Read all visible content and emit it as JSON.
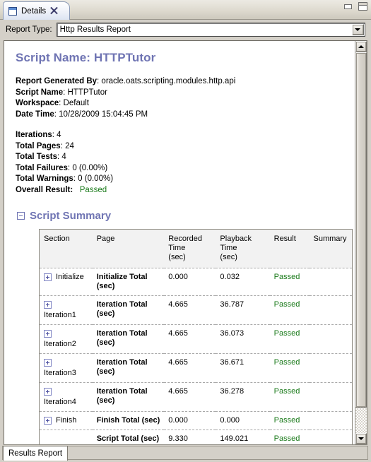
{
  "window": {
    "tab_label": "Details",
    "doc_icon": "document-icon",
    "close_icon": "close-icon",
    "minimize_icon": "minimize-icon",
    "maximize_icon": "maximize-icon"
  },
  "toolbar": {
    "report_type_label": "Report Type:",
    "report_type_value": "Http Results Report",
    "dropdown_icon": "chevron-down-icon"
  },
  "report": {
    "title": "Script Name: HTTPTutor",
    "meta": [
      {
        "label": "Report Generated By",
        "value": "oracle.oats.scripting.modules.http.api"
      },
      {
        "label": "Script Name",
        "value": "HTTPTutor"
      },
      {
        "label": "Workspace",
        "value": "Default"
      },
      {
        "label": "Date Time",
        "value": "10/28/2009 15:04:45 PM"
      }
    ],
    "stats": [
      {
        "label": "Iterations",
        "value": "4"
      },
      {
        "label": "Total Pages",
        "value": "24"
      },
      {
        "label": "Total Tests",
        "value": "4"
      },
      {
        "label": "Total Failures",
        "value": "0 (0.00%)"
      },
      {
        "label": "Total Warnings",
        "value": "0 (0.00%)"
      }
    ],
    "overall": {
      "label": "Overall Result:",
      "value": "Passed",
      "color": "#1a7a1a"
    }
  },
  "script_summary": {
    "heading": "Script Summary",
    "collapse_icon": "minus-box-icon",
    "columns": [
      "Section",
      "Page",
      "Recorded Time (sec)",
      "Playback Time (sec)",
      "Result",
      "Summary"
    ],
    "columns_split": [
      {
        "line1": "Section",
        "line2": ""
      },
      {
        "line1": "Page",
        "line2": ""
      },
      {
        "line1": "Recorded Time",
        "line2": "(sec)"
      },
      {
        "line1": "Playback Time",
        "line2": "(sec)"
      },
      {
        "line1": "Result",
        "line2": ""
      },
      {
        "line1": "Summary",
        "line2": ""
      }
    ],
    "rows": [
      {
        "expandable": true,
        "layout": "inline",
        "section": "Initialize",
        "page": "Initialize Total (sec)",
        "recorded_time": "0.000",
        "playback_time": "0.032",
        "result": "Passed",
        "summary": ""
      },
      {
        "expandable": true,
        "layout": "stacked",
        "section": "Iteration1",
        "page": "Iteration Total (sec)",
        "recorded_time": "4.665",
        "playback_time": "36.787",
        "result": "Passed",
        "summary": ""
      },
      {
        "expandable": true,
        "layout": "stacked",
        "section": "Iteration2",
        "page": "Iteration Total (sec)",
        "recorded_time": "4.665",
        "playback_time": "36.073",
        "result": "Passed",
        "summary": ""
      },
      {
        "expandable": true,
        "layout": "stacked",
        "section": "Iteration3",
        "page": "Iteration Total (sec)",
        "recorded_time": "4.665",
        "playback_time": "36.671",
        "result": "Passed",
        "summary": ""
      },
      {
        "expandable": true,
        "layout": "stacked",
        "section": "Iteration4",
        "page": "Iteration Total (sec)",
        "recorded_time": "4.665",
        "playback_time": "36.278",
        "result": "Passed",
        "summary": ""
      },
      {
        "expandable": true,
        "layout": "inline",
        "section": "Finish",
        "page": "Finish Total (sec)",
        "recorded_time": "0.000",
        "playback_time": "0.000",
        "result": "Passed",
        "summary": ""
      },
      {
        "expandable": false,
        "layout": "inline",
        "section": "",
        "page": "Script Total (sec)",
        "recorded_time": "9.330",
        "playback_time": "149.021",
        "result": "Passed",
        "summary": ""
      }
    ]
  },
  "scrollbar": {
    "up_icon": "scroll-up-icon",
    "down_icon": "scroll-down-icon"
  },
  "bottom": {
    "tab_label": "Results Report"
  },
  "colors": {
    "heading": "#6f74b3",
    "passed": "#1a7a1a",
    "chrome": "#d4d0c8"
  }
}
